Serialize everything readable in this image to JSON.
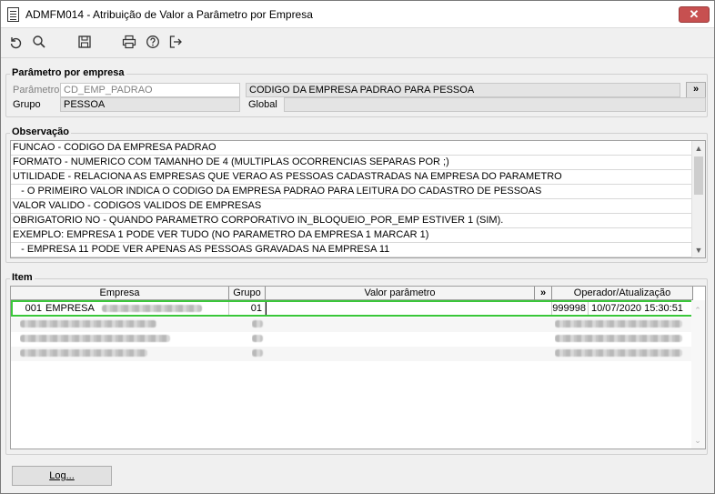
{
  "window": {
    "title": "ADMFM014 - Atribuição de Valor a Parâmetro por Empresa",
    "close_label": "✕"
  },
  "toolbar": {
    "icons": [
      "undo-icon",
      "search-icon",
      "save-icon",
      "print-icon",
      "help-icon",
      "exit-icon"
    ]
  },
  "parametro_por_empresa": {
    "legend": "Parâmetro por empresa",
    "parametro_label": "Parâmetro",
    "parametro_value": "CD_EMP_PADRAO",
    "parametro_description": "CODIGO DA EMPRESA PADRAO PARA PESSOA",
    "expand_label": "»",
    "grupo_label": "Grupo",
    "grupo_value": "PESSOA",
    "global_label": "Global",
    "global_value": ""
  },
  "observacao": {
    "legend": "Observação",
    "lines": [
      "FUNCAO - CODIGO DA EMPRESA PADRAO",
      "FORMATO - NUMERICO COM TAMANHO DE 4 (MULTIPLAS OCORRENCIAS SEPARAS POR ;)",
      "UTILIDADE - RELACIONA AS EMPRESAS QUE VERAO AS PESSOAS CADASTRADAS NA EMPRESA DO PARAMETRO",
      "   - O PRIMEIRO VALOR INDICA O CODIGO DA EMPRESA PADRAO PARA LEITURA DO CADASTRO DE PESSOAS",
      "VALOR VALIDO - CODIGOS VALIDOS DE EMPRESAS",
      "OBRIGATORIO NO - QUANDO PARAMETRO CORPORATIVO IN_BLOQUEIO_POR_EMP ESTIVER 1 (SIM).",
      "EXEMPLO: EMPRESA 1 PODE VER TUDO (NO PARAMETRO DA EMPRESA 1 MARCAR 1)",
      "   - EMPRESA 11 PODE VER APENAS AS PESSOAS GRAVADAS NA EMPRESA 11"
    ]
  },
  "item": {
    "legend": "Item",
    "columns": {
      "empresa": "Empresa",
      "grupo": "Grupo",
      "valor": "Valor parâmetro",
      "expand": "»",
      "operador": "Operador/Atualização"
    },
    "rows": [
      {
        "codigo": "001",
        "empresa": "EMPRESA",
        "grupo": "01",
        "valor": "",
        "operador": "999998",
        "atualizacao": "10/07/2020 15:30:51"
      }
    ]
  },
  "footer": {
    "log_label": "Log..."
  }
}
